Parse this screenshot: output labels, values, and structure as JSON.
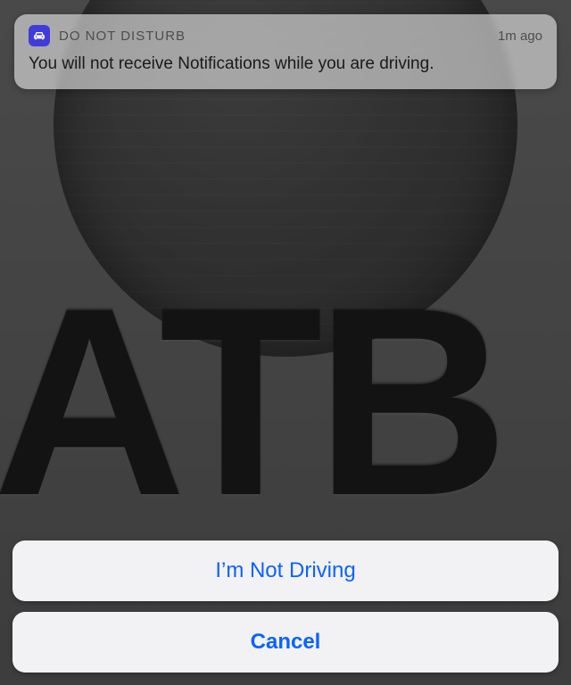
{
  "wallpaper": {
    "brand_text": "ATB"
  },
  "notification": {
    "app_name": "DO NOT DISTURB",
    "timestamp_relative": "1m ago",
    "icon": "car-icon",
    "message": "You will not receive Notifications while you are driving."
  },
  "action_sheet": {
    "primary_label": "I’m Not Driving",
    "cancel_label": "Cancel"
  }
}
